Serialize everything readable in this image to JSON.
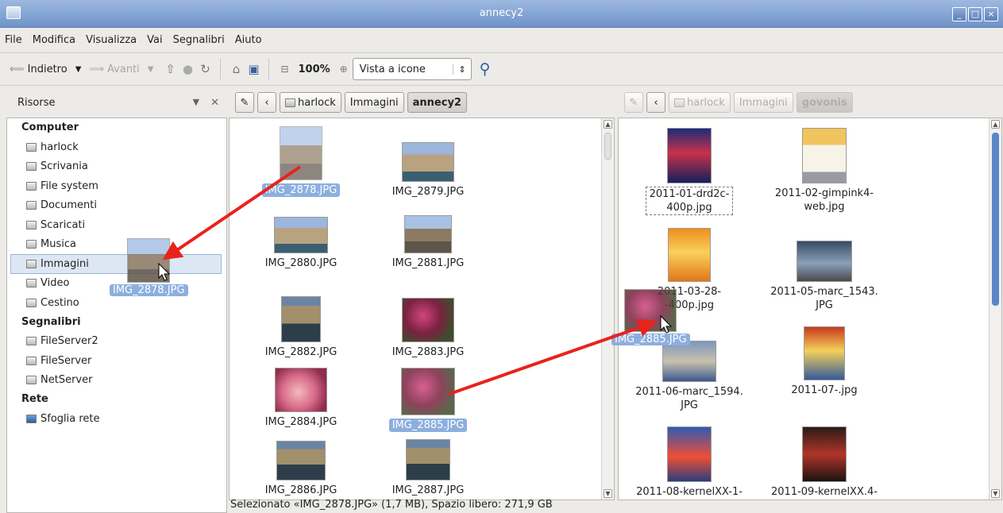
{
  "window": {
    "title": "annecy2",
    "controls": [
      "_",
      "□",
      "×"
    ]
  },
  "menu": [
    "File",
    "Modifica",
    "Visualizza",
    "Vai",
    "Segnalibri",
    "Aiuto"
  ],
  "toolbar": {
    "back": "Indietro",
    "forward": "Avanti",
    "zoom": "100%",
    "view_mode": "Vista a icone"
  },
  "sidebar": {
    "title": "Risorse",
    "sections": [
      {
        "label": "Computer",
        "items": [
          "harlock",
          "Scrivania",
          "File system",
          "Documenti",
          "Scaricati",
          "Musica",
          "Immagini",
          "Video",
          "Cestino"
        ]
      },
      {
        "label": "Segnalibri",
        "items": [
          "FileServer2",
          "FileServer",
          "NetServer"
        ]
      },
      {
        "label": "Rete",
        "items": [
          "Sfoglia rete"
        ]
      }
    ]
  },
  "left_pane": {
    "path": [
      "harlock",
      "Immagini",
      "annecy2"
    ],
    "items": [
      {
        "name": "IMG_2878.JPG",
        "selected": true
      },
      {
        "name": "IMG_2879.JPG"
      },
      {
        "name": "IMG_2880.JPG"
      },
      {
        "name": "IMG_2881.JPG"
      },
      {
        "name": "IMG_2882.JPG"
      },
      {
        "name": "IMG_2883.JPG"
      },
      {
        "name": "IMG_2884.JPG"
      },
      {
        "name": "IMG_2885.JPG",
        "selected": true
      },
      {
        "name": "IMG_2886.JPG"
      },
      {
        "name": "IMG_2887.JPG"
      }
    ]
  },
  "right_pane": {
    "path": [
      "harlock",
      "Immagini",
      "govonis"
    ],
    "items": [
      {
        "line1": "2011-01-drd2c-",
        "line2": "400p.jpg"
      },
      {
        "line1": "2011-02-gimpink4-",
        "line2": "web.jpg"
      },
      {
        "line1": "2011-03-28-",
        "line2": "-400p.jpg"
      },
      {
        "line1": "2011-05-marc_1543.",
        "line2": "JPG"
      },
      {
        "line1": "2011-06-marc_1594.",
        "line2": "JPG"
      },
      {
        "line1": "2011-07-.jpg",
        "line2": ""
      },
      {
        "line1": "2011-08-kernelXX-1-",
        "line2": ""
      },
      {
        "line1": "2011-09-kernelXX.4-",
        "line2": ""
      }
    ]
  },
  "drag": {
    "left": "IMG_2878.JPG",
    "right": "IMG_2885.JPG"
  },
  "status": "Selezionato «IMG_2878.JPG» (1,7 MB), Spazio libero: 271,9 GB",
  "colors": {
    "selection": "#8cafde",
    "arrow": "#e8231c",
    "titlebar": "#7b9dd0"
  }
}
